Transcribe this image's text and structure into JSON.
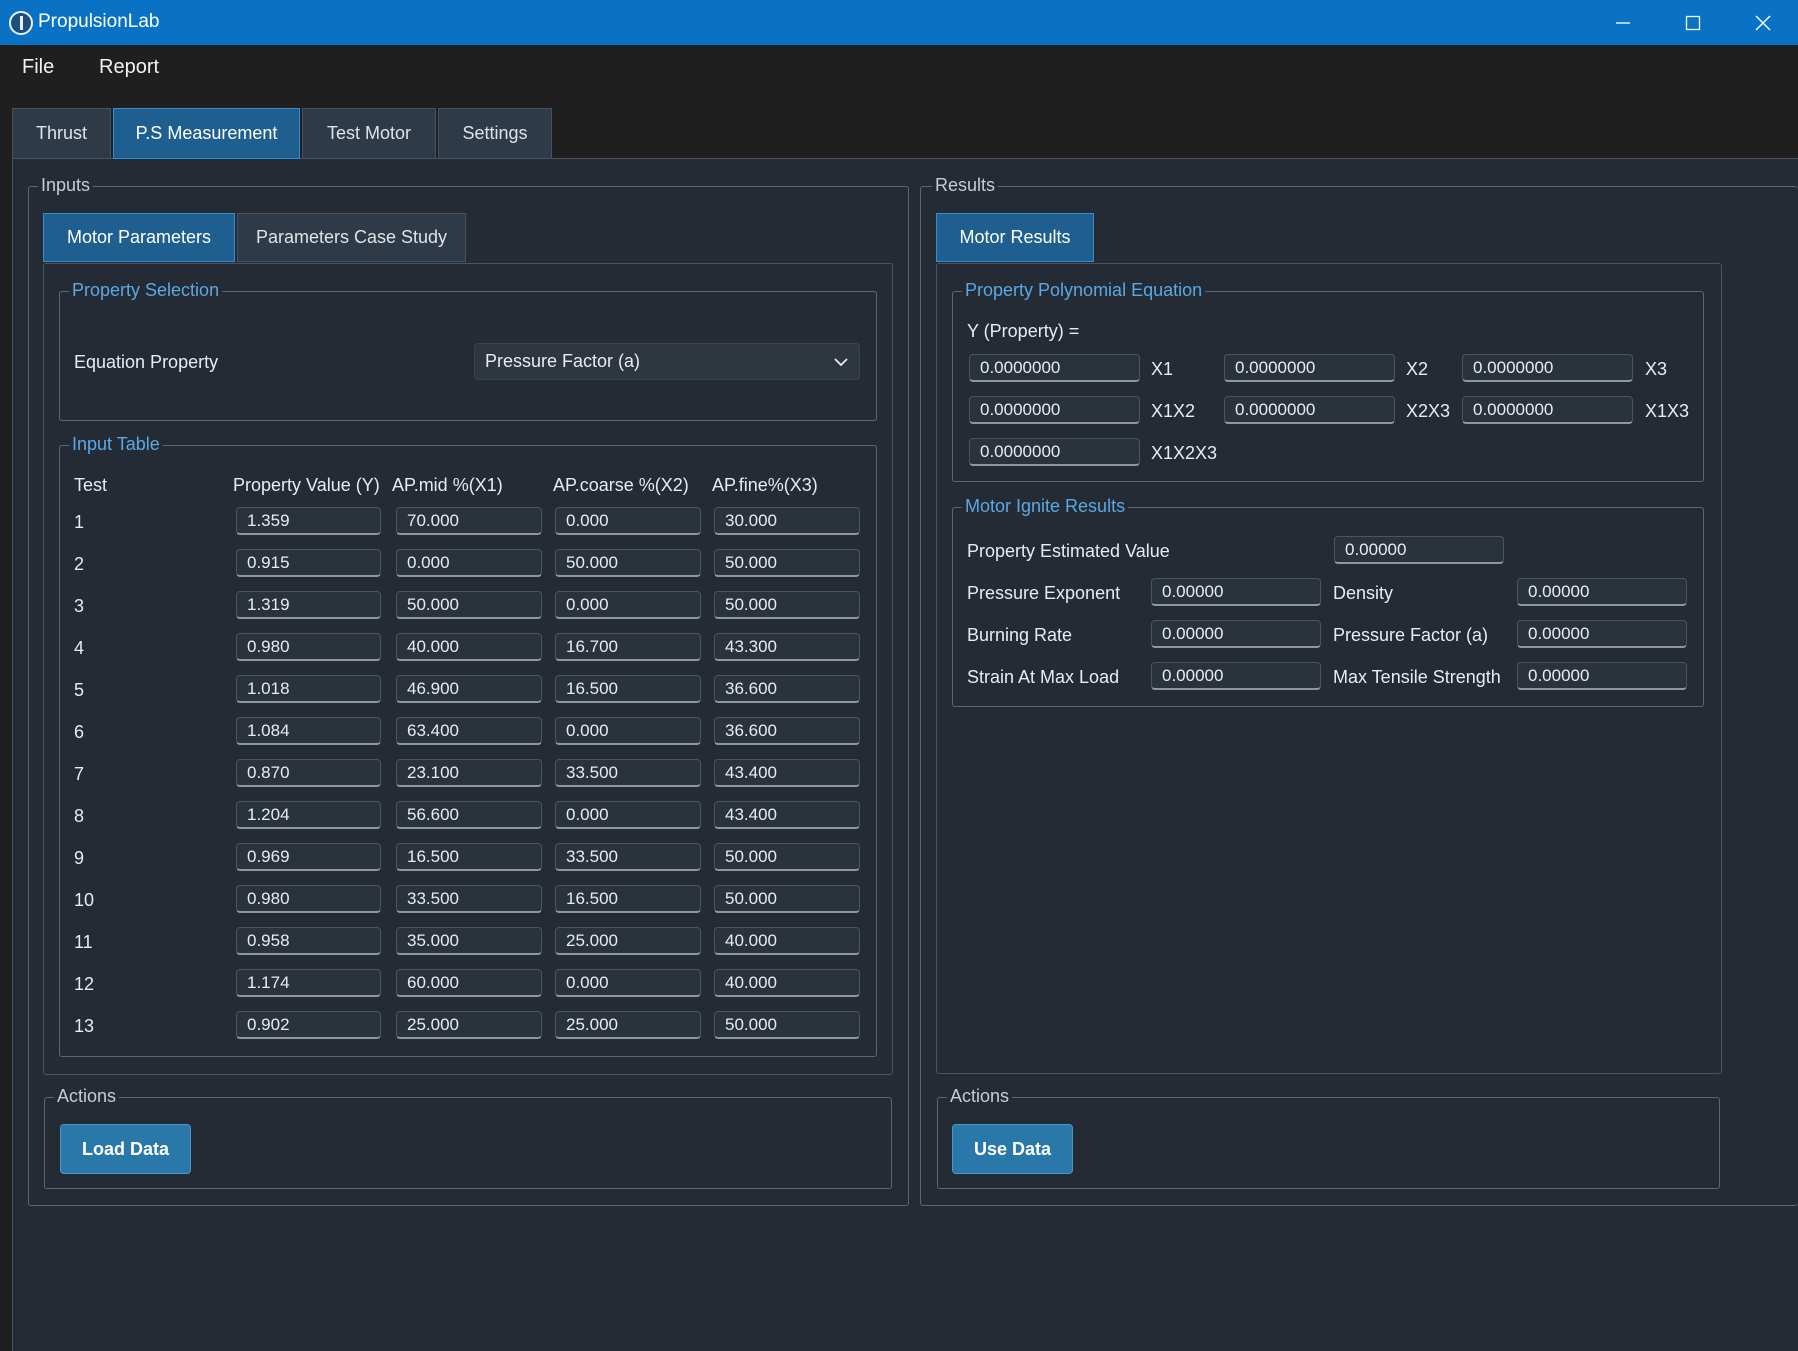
{
  "window": {
    "title": "PropulsionLab"
  },
  "menu": {
    "file": "File",
    "report": "Report"
  },
  "tabs": [
    "Thrust",
    "P.S Measurement",
    "Test Motor",
    "Settings"
  ],
  "inputs": {
    "legend": "Inputs",
    "subtabs": [
      "Motor Parameters",
      "Parameters Case Study"
    ],
    "property_selection": {
      "legend": "Property Selection",
      "label": "Equation Property",
      "selected": "Pressure Factor (a)"
    },
    "table": {
      "legend": "Input Table",
      "headers": [
        "Test",
        "Property Value (Y)",
        "AP.mid %(X1)",
        "AP.coarse %(X2)",
        "AP.fine%(X3)"
      ],
      "rows": [
        [
          "1",
          "1.359",
          "70.000",
          "0.000",
          "30.000"
        ],
        [
          "2",
          "0.915",
          "0.000",
          "50.000",
          "50.000"
        ],
        [
          "3",
          "1.319",
          "50.000",
          "0.000",
          "50.000"
        ],
        [
          "4",
          "0.980",
          "40.000",
          "16.700",
          "43.300"
        ],
        [
          "5",
          "1.018",
          "46.900",
          "16.500",
          "36.600"
        ],
        [
          "6",
          "1.084",
          "63.400",
          "0.000",
          "36.600"
        ],
        [
          "7",
          "0.870",
          "23.100",
          "33.500",
          "43.400"
        ],
        [
          "8",
          "1.204",
          "56.600",
          "0.000",
          "43.400"
        ],
        [
          "9",
          "0.969",
          "16.500",
          "33.500",
          "50.000"
        ],
        [
          "10",
          "0.980",
          "33.500",
          "16.500",
          "50.000"
        ],
        [
          "11",
          "0.958",
          "35.000",
          "25.000",
          "40.000"
        ],
        [
          "12",
          "1.174",
          "60.000",
          "0.000",
          "40.000"
        ],
        [
          "13",
          "0.902",
          "25.000",
          "25.000",
          "50.000"
        ]
      ]
    },
    "actions": {
      "legend": "Actions",
      "button": "Load Data"
    }
  },
  "results": {
    "legend": "Results",
    "subtab": "Motor Results",
    "polynomial": {
      "legend": "Property Polynomial Equation",
      "y_label": "Y (Property) =",
      "terms": [
        {
          "value": "0.0000000",
          "label": "X1"
        },
        {
          "value": "0.0000000",
          "label": "X2"
        },
        {
          "value": "0.0000000",
          "label": "X3"
        },
        {
          "value": "0.0000000",
          "label": "X1X2"
        },
        {
          "value": "0.0000000",
          "label": "X2X3"
        },
        {
          "value": "0.0000000",
          "label": "X1X3"
        },
        {
          "value": "0.0000000",
          "label": "X1X2X3"
        }
      ]
    },
    "ignite": {
      "legend": "Motor Ignite Results",
      "estimated": {
        "label": "Property Estimated Value",
        "value": "0.00000"
      },
      "pressure_exponent": {
        "label": "Pressure Exponent",
        "value": "0.00000"
      },
      "density": {
        "label": "Density",
        "value": "0.00000"
      },
      "burning_rate": {
        "label": "Burning Rate",
        "value": "0.00000"
      },
      "pressure_factor": {
        "label": "Pressure Factor (a)",
        "value": "0.00000"
      },
      "strain": {
        "label": "Strain At Max Load",
        "value": "0.00000"
      },
      "tensile": {
        "label": "Max Tensile Strength",
        "value": "0.00000"
      }
    },
    "actions": {
      "legend": "Actions",
      "button": "Use Data"
    }
  },
  "colors": {
    "accent": "#0a72c5",
    "active_tab": "#1f5f8f",
    "button": "#2a77aa",
    "legend": "#5ba8e3",
    "panel": "#242b35"
  }
}
